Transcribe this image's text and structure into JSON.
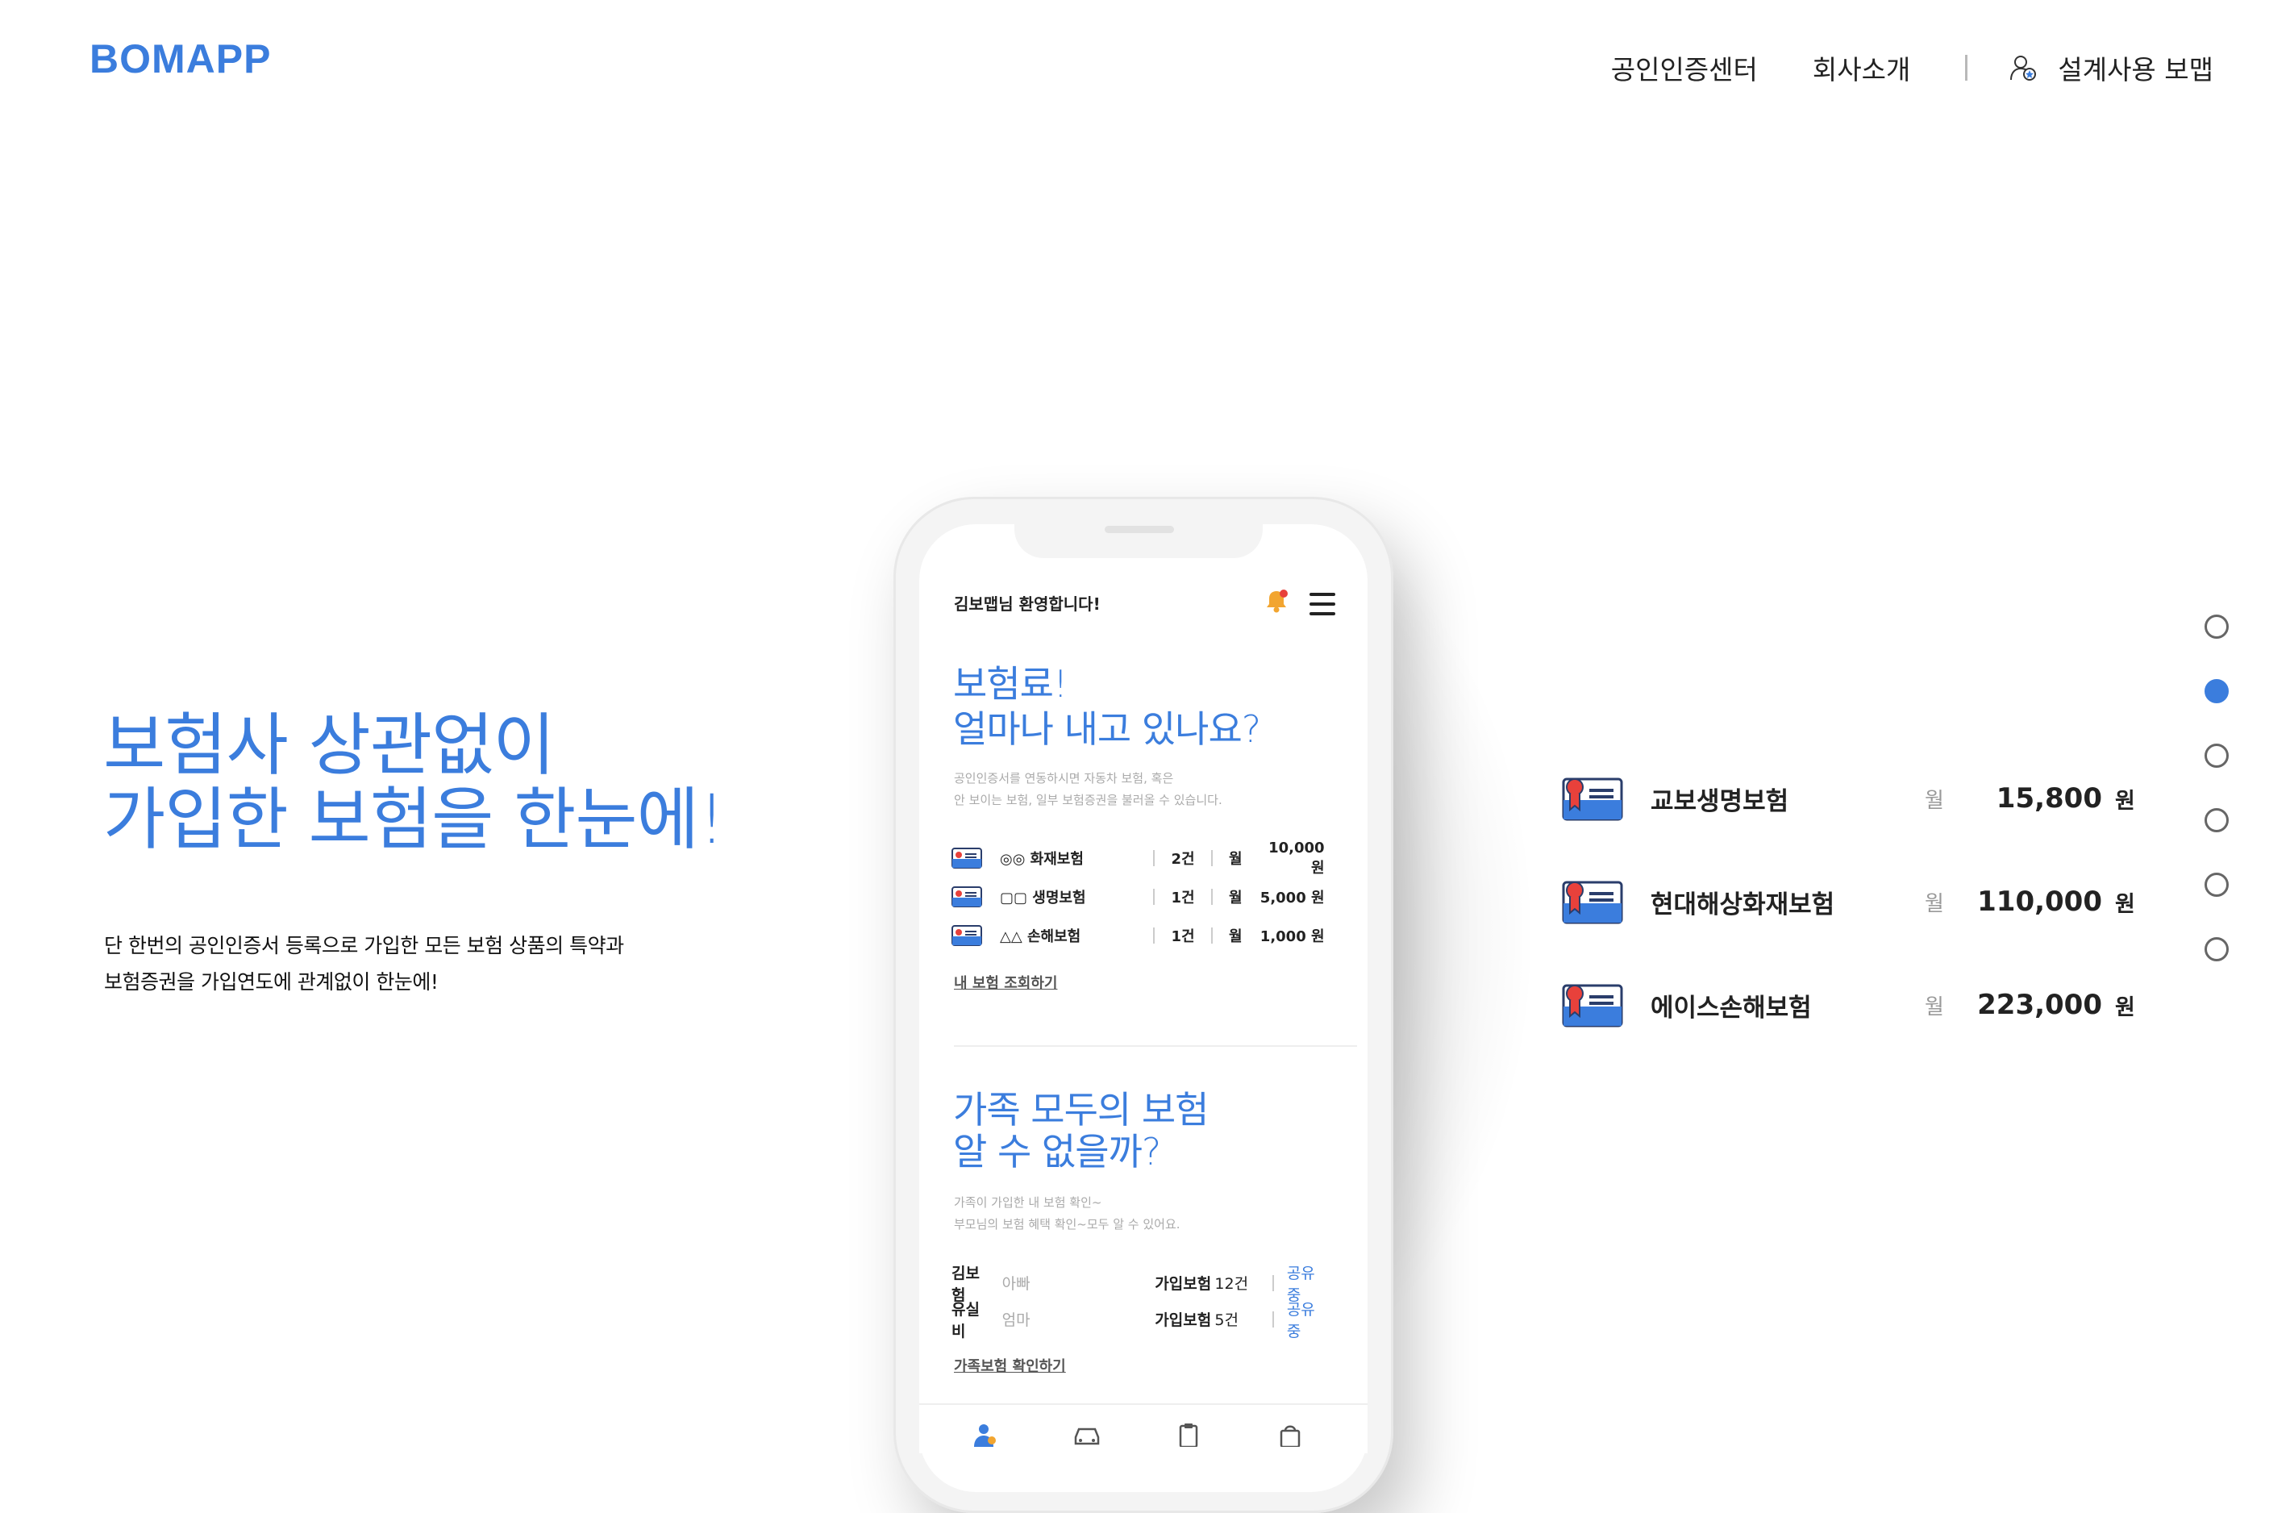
{
  "header": {
    "logo": "BOMAPP",
    "nav": [
      "공인인증센터",
      "회사소개"
    ],
    "user_label": "설계사용 보맵"
  },
  "hero": {
    "title_line1": "보험사 상관없이",
    "title_line2": "가입한 보험을 한눈에!",
    "desc_line1": "단 한번의 공인인증서 등록으로 가입한 모든 보험 상품의 특약과",
    "desc_line2": "보험증권을 가입연도에 관계없이 한눈에!"
  },
  "phone": {
    "welcome": "김보맵님 환영합니다!",
    "section1": {
      "title_line1": "보험료!",
      "title_line2": "얼마나 내고 있나요?",
      "desc_line1": "공인인증서를 연동하시면 자동차 보험, 혹은",
      "desc_line2": "안 보이는 보험, 일부 보험증권을 불러올 수 있습니다.",
      "items": [
        {
          "name": "◎◎ 화재보험",
          "count": "2건",
          "monthly": "월",
          "amount": "10,000 원"
        },
        {
          "name": "▢▢ 생명보험",
          "count": "1건",
          "monthly": "월",
          "amount": "5,000 원"
        },
        {
          "name": "△△ 손해보험",
          "count": "1건",
          "monthly": "월",
          "amount": "1,000 원"
        }
      ],
      "link": "내 보험 조회하기"
    },
    "section2": {
      "title_line1": "가족 모두의 보험",
      "title_line2": "알 수 없을까?",
      "desc_line1": "가족이 가입한 내 보험 확인~",
      "desc_line2": "부모님의 보험 혜택 확인~모두 알 수 있어요.",
      "members": [
        {
          "name": "김보험",
          "relation": "아빠",
          "label": "가입보험",
          "count": "12건",
          "status": "공유 중"
        },
        {
          "name": "유실비",
          "relation": "엄마",
          "label": "가입보험",
          "count": "5건",
          "status": "공유 중"
        }
      ],
      "link": "가족보험 확인하기"
    }
  },
  "cards": [
    {
      "name": "교보생명보험",
      "monthly": "월",
      "amount": "15,800",
      "unit": "원"
    },
    {
      "name": "현대해상화재보험",
      "monthly": "월",
      "amount": "110,000",
      "unit": "원"
    },
    {
      "name": "에이스손해보험",
      "monthly": "월",
      "amount": "223,000",
      "unit": "원"
    }
  ],
  "pagination": {
    "total": 6,
    "active_index": 1
  },
  "colors": {
    "accent": "#3b7ddd",
    "card_red": "#e8413b"
  }
}
